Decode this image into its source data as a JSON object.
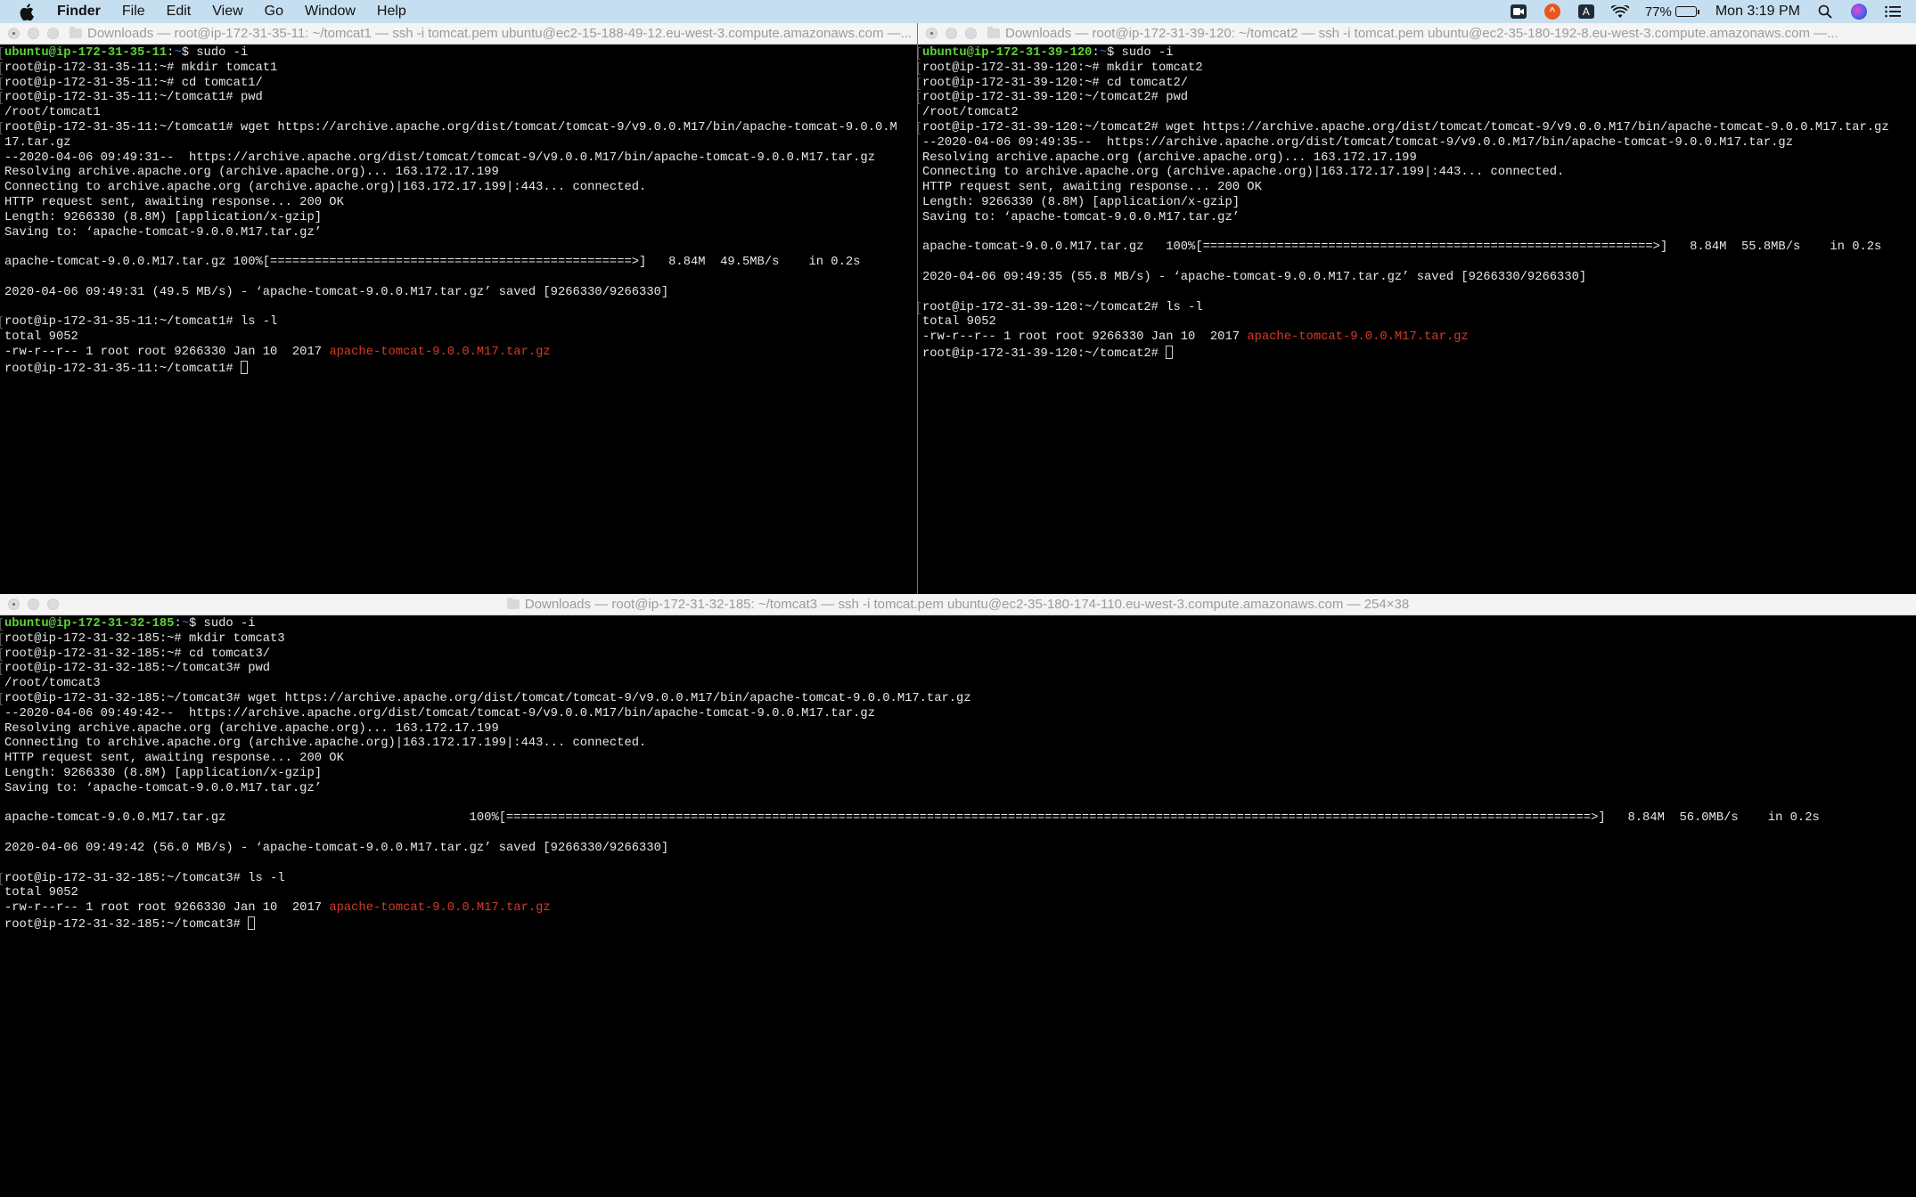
{
  "menubar": {
    "apple_icon": "apple-logo",
    "app_name": "Finder",
    "menus": [
      "File",
      "Edit",
      "View",
      "Go",
      "Window",
      "Help"
    ],
    "status": {
      "icons": [
        "zoom-icon",
        "brave-icon",
        "input-source-icon",
        "wifi-icon"
      ],
      "input_source_label": "A",
      "battery_percent": "77%",
      "battery_level": 0.77,
      "clock": "Mon 3:19 PM",
      "right_icons": [
        "spotlight-search-icon",
        "siri-icon",
        "notification-center-icon"
      ]
    }
  },
  "windows": [
    {
      "id": "tomcat1",
      "title": "Downloads — root@ip-172-31-35-11: ~/tomcat1 — ssh -i tomcat.pem ubuntu@ec2-15-188-49-12.eu-west-3.compute.amazonaws.com —...",
      "lines": [
        {
          "segments": [
            {
              "t": "ubuntu@ip-172-31-35-11",
              "c": "ubuntu"
            },
            {
              "t": ":"
            },
            {
              "t": "~",
              "c": "tilde"
            },
            {
              "t": "$ sudo -i"
            }
          ],
          "mark": true
        },
        {
          "segments": [
            {
              "t": "root@ip-172-31-35-11:~# mkdir tomcat1"
            }
          ],
          "mark": true
        },
        {
          "segments": [
            {
              "t": "root@ip-172-31-35-11:~# cd tomcat1/"
            }
          ],
          "mark": true
        },
        {
          "segments": [
            {
              "t": "root@ip-172-31-35-11:~/tomcat1# pwd"
            }
          ],
          "mark": true
        },
        {
          "segments": [
            {
              "t": "/root/tomcat1"
            }
          ]
        },
        {
          "segments": [
            {
              "t": "root@ip-172-31-35-11:~/tomcat1# wget https://archive.apache.org/dist/tomcat/tomcat-9/v9.0.0.M17/bin/apache-tomcat-9.0.0.M"
            }
          ],
          "mark": true
        },
        {
          "segments": [
            {
              "t": "17.tar.gz"
            }
          ]
        },
        {
          "segments": [
            {
              "t": "--2020-04-06 09:49:31--  https://archive.apache.org/dist/tomcat/tomcat-9/v9.0.0.M17/bin/apache-tomcat-9.0.0.M17.tar.gz"
            }
          ]
        },
        {
          "segments": [
            {
              "t": "Resolving archive.apache.org (archive.apache.org)... 163.172.17.199"
            }
          ]
        },
        {
          "segments": [
            {
              "t": "Connecting to archive.apache.org (archive.apache.org)|163.172.17.199|:443... connected."
            }
          ]
        },
        {
          "segments": [
            {
              "t": "HTTP request sent, awaiting response... 200 OK"
            }
          ]
        },
        {
          "segments": [
            {
              "t": "Length: 9266330 (8.8M) [application/x-gzip]"
            }
          ]
        },
        {
          "segments": [
            {
              "t": "Saving to: ‘apache-tomcat-9.0.0.M17.tar.gz’"
            }
          ]
        },
        {
          "segments": [
            {
              "t": ""
            }
          ]
        },
        {
          "segments": [
            {
              "t": "apache-tomcat-9.0.0.M17.tar.gz 100%[=================================================>]   8.84M  49.5MB/s    in 0.2s"
            }
          ]
        },
        {
          "segments": [
            {
              "t": ""
            }
          ]
        },
        {
          "segments": [
            {
              "t": "2020-04-06 09:49:31 (49.5 MB/s) - ‘apache-tomcat-9.0.0.M17.tar.gz’ saved [9266330/9266330]"
            }
          ]
        },
        {
          "segments": [
            {
              "t": ""
            }
          ]
        },
        {
          "segments": [
            {
              "t": "root@ip-172-31-35-11:~/tomcat1# ls -l"
            }
          ],
          "mark": true
        },
        {
          "segments": [
            {
              "t": "total 9052"
            }
          ]
        },
        {
          "segments": [
            {
              "t": "-rw-r--r-- 1 root root 9266330 Jan 10  2017 "
            },
            {
              "t": "apache-tomcat-9.0.0.M17.tar.gz",
              "c": "red"
            }
          ]
        },
        {
          "segments": [
            {
              "t": "root@ip-172-31-35-11:~/tomcat1# "
            }
          ],
          "cursor": true
        }
      ]
    },
    {
      "id": "tomcat2",
      "title": "Downloads — root@ip-172-31-39-120: ~/tomcat2 — ssh -i tomcat.pem ubuntu@ec2-35-180-192-8.eu-west-3.compute.amazonaws.com —...",
      "lines": [
        {
          "segments": [
            {
              "t": "ubuntu@ip-172-31-39-120",
              "c": "ubuntu"
            },
            {
              "t": ":"
            },
            {
              "t": "~",
              "c": "tilde"
            },
            {
              "t": "$ sudo -i"
            }
          ],
          "mark": true
        },
        {
          "segments": [
            {
              "t": "root@ip-172-31-39-120:~# mkdir tomcat2"
            }
          ],
          "mark": true
        },
        {
          "segments": [
            {
              "t": "root@ip-172-31-39-120:~# cd tomcat2/"
            }
          ],
          "mark": true
        },
        {
          "segments": [
            {
              "t": "root@ip-172-31-39-120:~/tomcat2# pwd"
            }
          ],
          "mark": true
        },
        {
          "segments": [
            {
              "t": "/root/tomcat2"
            }
          ]
        },
        {
          "segments": [
            {
              "t": "root@ip-172-31-39-120:~/tomcat2# wget https://archive.apache.org/dist/tomcat/tomcat-9/v9.0.0.M17/bin/apache-tomcat-9.0.0.M17.tar.gz"
            }
          ],
          "mark": true
        },
        {
          "segments": [
            {
              "t": "--2020-04-06 09:49:35--  https://archive.apache.org/dist/tomcat/tomcat-9/v9.0.0.M17/bin/apache-tomcat-9.0.0.M17.tar.gz"
            }
          ]
        },
        {
          "segments": [
            {
              "t": "Resolving archive.apache.org (archive.apache.org)... 163.172.17.199"
            }
          ]
        },
        {
          "segments": [
            {
              "t": "Connecting to archive.apache.org (archive.apache.org)|163.172.17.199|:443... connected."
            }
          ]
        },
        {
          "segments": [
            {
              "t": "HTTP request sent, awaiting response... 200 OK"
            }
          ]
        },
        {
          "segments": [
            {
              "t": "Length: 9266330 (8.8M) [application/x-gzip]"
            }
          ]
        },
        {
          "segments": [
            {
              "t": "Saving to: ‘apache-tomcat-9.0.0.M17.tar.gz’"
            }
          ]
        },
        {
          "segments": [
            {
              "t": ""
            }
          ]
        },
        {
          "segments": [
            {
              "t": "apache-tomcat-9.0.0.M17.tar.gz   100%[=============================================================>]   8.84M  55.8MB/s    in 0.2s"
            }
          ]
        },
        {
          "segments": [
            {
              "t": ""
            }
          ]
        },
        {
          "segments": [
            {
              "t": "2020-04-06 09:49:35 (55.8 MB/s) - ‘apache-tomcat-9.0.0.M17.tar.gz’ saved [9266330/9266330]"
            }
          ]
        },
        {
          "segments": [
            {
              "t": ""
            }
          ]
        },
        {
          "segments": [
            {
              "t": "root@ip-172-31-39-120:~/tomcat2# ls -l"
            }
          ],
          "mark": true
        },
        {
          "segments": [
            {
              "t": "total 9052"
            }
          ]
        },
        {
          "segments": [
            {
              "t": "-rw-r--r-- 1 root root 9266330 Jan 10  2017 "
            },
            {
              "t": "apache-tomcat-9.0.0.M17.tar.gz",
              "c": "red"
            }
          ]
        },
        {
          "segments": [
            {
              "t": "root@ip-172-31-39-120:~/tomcat2# "
            }
          ],
          "cursor": true
        }
      ]
    },
    {
      "id": "tomcat3",
      "title": "Downloads — root@ip-172-31-32-185: ~/tomcat3 — ssh -i tomcat.pem ubuntu@ec2-35-180-174-110.eu-west-3.compute.amazonaws.com — 254×38",
      "lines": [
        {
          "segments": [
            {
              "t": "ubuntu@ip-172-31-32-185",
              "c": "ubuntu"
            },
            {
              "t": ":"
            },
            {
              "t": "~",
              "c": "tilde"
            },
            {
              "t": "$ sudo -i"
            }
          ],
          "mark": true
        },
        {
          "segments": [
            {
              "t": "root@ip-172-31-32-185:~# mkdir tomcat3"
            }
          ],
          "mark": true
        },
        {
          "segments": [
            {
              "t": "root@ip-172-31-32-185:~# cd tomcat3/"
            }
          ],
          "mark": true
        },
        {
          "segments": [
            {
              "t": "root@ip-172-31-32-185:~/tomcat3# pwd"
            }
          ],
          "mark": true
        },
        {
          "segments": [
            {
              "t": "/root/tomcat3"
            }
          ]
        },
        {
          "segments": [
            {
              "t": "root@ip-172-31-32-185:~/tomcat3# wget https://archive.apache.org/dist/tomcat/tomcat-9/v9.0.0.M17/bin/apache-tomcat-9.0.0.M17.tar.gz"
            }
          ],
          "mark": true
        },
        {
          "segments": [
            {
              "t": "--2020-04-06 09:49:42--  https://archive.apache.org/dist/tomcat/tomcat-9/v9.0.0.M17/bin/apache-tomcat-9.0.0.M17.tar.gz"
            }
          ]
        },
        {
          "segments": [
            {
              "t": "Resolving archive.apache.org (archive.apache.org)... 163.172.17.199"
            }
          ]
        },
        {
          "segments": [
            {
              "t": "Connecting to archive.apache.org (archive.apache.org)|163.172.17.199|:443... connected."
            }
          ]
        },
        {
          "segments": [
            {
              "t": "HTTP request sent, awaiting response... 200 OK"
            }
          ]
        },
        {
          "segments": [
            {
              "t": "Length: 9266330 (8.8M) [application/x-gzip]"
            }
          ]
        },
        {
          "segments": [
            {
              "t": "Saving to: ‘apache-tomcat-9.0.0.M17.tar.gz’"
            }
          ]
        },
        {
          "segments": [
            {
              "t": ""
            }
          ]
        },
        {
          "segments": [
            {
              "t": "apache-tomcat-9.0.0.M17.tar.gz                                 100%[===================================================================================================================================================>]   8.84M  56.0MB/s    in 0.2s"
            }
          ]
        },
        {
          "segments": [
            {
              "t": ""
            }
          ]
        },
        {
          "segments": [
            {
              "t": "2020-04-06 09:49:42 (56.0 MB/s) - ‘apache-tomcat-9.0.0.M17.tar.gz’ saved [9266330/9266330]"
            }
          ]
        },
        {
          "segments": [
            {
              "t": ""
            }
          ]
        },
        {
          "segments": [
            {
              "t": "root@ip-172-31-32-185:~/tomcat3# ls -l"
            }
          ],
          "mark": true
        },
        {
          "segments": [
            {
              "t": "total 9052"
            }
          ]
        },
        {
          "segments": [
            {
              "t": "-rw-r--r-- 1 root root 9266330 Jan 10  2017 "
            },
            {
              "t": "apache-tomcat-9.0.0.M17.tar.gz",
              "c": "red"
            }
          ]
        },
        {
          "segments": [
            {
              "t": "root@ip-172-31-32-185:~/tomcat3# "
            }
          ],
          "cursor": true
        }
      ]
    }
  ],
  "colors": {
    "terminal_bg": "#000000",
    "terminal_fg": "#e6e6e6",
    "prompt_user": "#5fd33a",
    "prompt_tilde": "#3a6ee0",
    "archive_file": "#d63a2a",
    "menubar_bg": "#c6dff0",
    "titlebar_bg": "#f4f4f4"
  }
}
